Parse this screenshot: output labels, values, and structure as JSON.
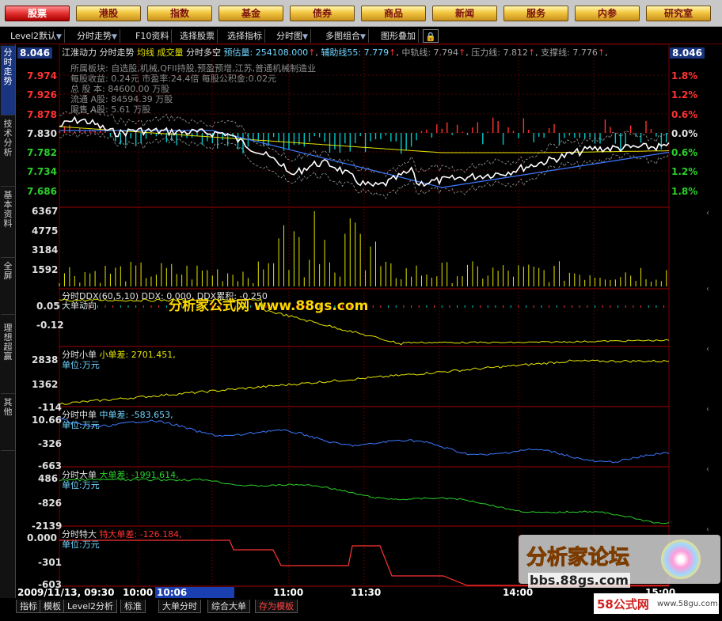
{
  "nav": [
    "股票",
    "港股",
    "指数",
    "基金",
    "债券",
    "商品",
    "新闻",
    "服务",
    "内参",
    "研究室"
  ],
  "toolbar": {
    "items": [
      "Level2默认",
      "分时走势",
      "F10资料",
      "选择股票",
      "选择指标",
      "分时图",
      "多图组合",
      "图形叠加"
    ],
    "lock_icon": "lock-icon"
  },
  "sidetabs": [
    "分时走势",
    "技术分析",
    "基本资料",
    "全屏",
    "理想超赢",
    "其他"
  ],
  "header": {
    "stock": "江淮动力",
    "mode": "分时走势",
    "l1": "均线",
    "l2": "成交量",
    "l3": "分时多空",
    "estimate": "预估量: 254108.000",
    "aux": "辅助线55: 7.779",
    "mid": "中轨线: 7.794",
    "press": "压力线: 7.812",
    "support": "支撑线: 7.776",
    "price_right": "8.046"
  },
  "info": [
    "所属板块: 自选股,机械,QFII持股,预盈预增,江苏,普通机械制造业",
    "每股收益: 0.24元   市盈率:24.4倍   每股公积金:0.02元",
    "总 股 本: 84600.00  万股",
    "流通 A股: 84594.39  万股",
    "限售 A股: 5.61  万股"
  ],
  "price_axis_left": [
    "8.046",
    "7.974",
    "7.926",
    "7.878",
    "7.830",
    "7.782",
    "7.734",
    "7.686"
  ],
  "price_axis_right": [
    "8.046",
    "1.8%",
    "1.2%",
    "0.6%",
    "0.0%",
    "0.6%",
    "1.2%",
    "1.8%"
  ],
  "volume_axis": [
    "6367",
    "4775",
    "3184",
    "1592"
  ],
  "ddx": {
    "label": "分时DDX(60,5,10)",
    "ddx": "DDX: 0.000",
    "acc": "DDX累积: -0.250",
    "sub": "大单动向",
    "axis": [
      "0.05",
      "-0.12"
    ]
  },
  "small": {
    "label": "分时小单",
    "diff": "小单差: 2701.451,",
    "unit": "单位:万元",
    "axis": [
      "2838",
      "1362",
      "-114"
    ]
  },
  "mid_order": {
    "label": "分时中单",
    "diff": "中单差: -583.653,",
    "unit": "单位:万元",
    "axis": [
      "10.66",
      "-326",
      "-663"
    ]
  },
  "big": {
    "label": "分时大单",
    "diff": "大单差: -1991.614,",
    "unit": "单位:万元",
    "axis": [
      "486",
      "-826",
      "-2139"
    ]
  },
  "huge": {
    "label": "分时特大",
    "diff": "特大单差: -126.184,",
    "unit": "单位:万元",
    "axis": [
      "0.000",
      "-301",
      "-603"
    ]
  },
  "time_axis": {
    "date": "2009/11/13, 09:30",
    "t1": "10:00",
    "cursor": "10:06",
    "t2": "11:00",
    "t3": "11:30",
    "t4": "14:00",
    "t5": "15:00"
  },
  "overlay": "分析家公式网 www.88gs.com",
  "bottom_tabs": [
    "指标",
    "模板",
    "Level2分析",
    "标准",
    "大单分时",
    "综合大单",
    "存为模板"
  ],
  "watermark": {
    "title": "分析家论坛",
    "url": "bbs.88gs.com",
    "site": "58公式网",
    "site_url": "www.58gu.com"
  },
  "colors": {
    "up": "#ff3232",
    "down": "#00c8c8",
    "yellow": "#e6e600",
    "blue": "#3c78ff",
    "green": "#2ad02a",
    "cyan": "#6fd6ff"
  }
}
